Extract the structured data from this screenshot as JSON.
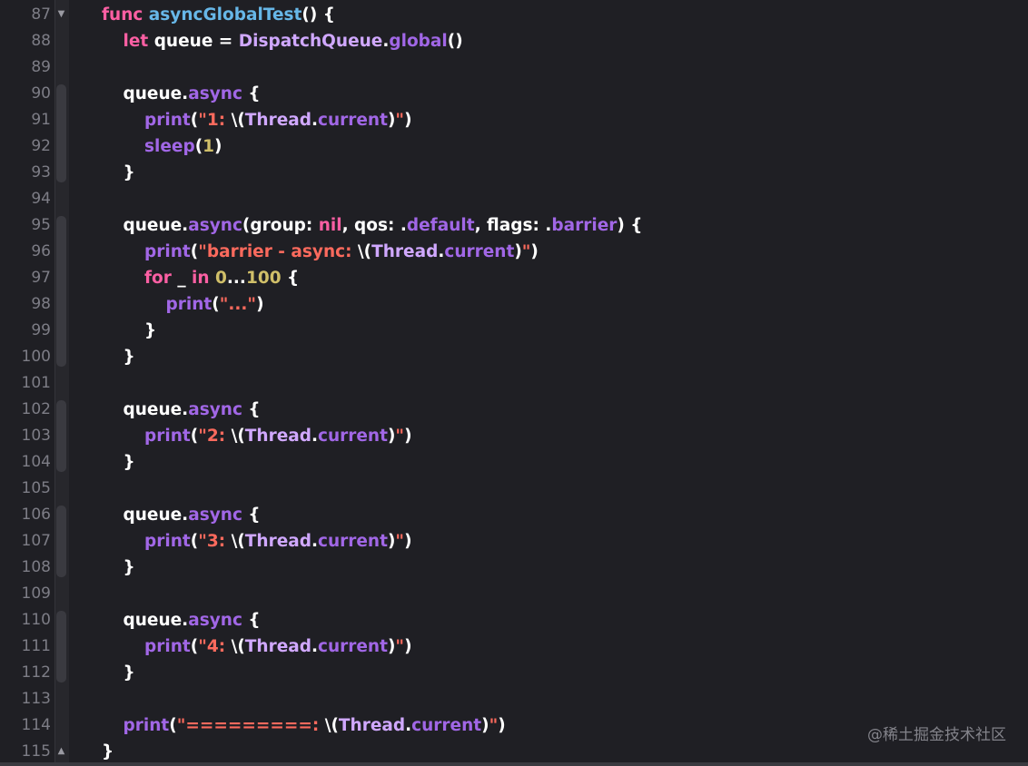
{
  "editor": {
    "lines": [
      {
        "n": "87",
        "indent": 0,
        "tokens": [
          [
            "kw",
            "func "
          ],
          [
            "fn",
            "asyncGlobalTest"
          ],
          [
            "pl",
            "() {"
          ]
        ]
      },
      {
        "n": "88",
        "indent": 1,
        "tokens": [
          [
            "kw",
            "let "
          ],
          [
            "pl",
            "queue = "
          ],
          [
            "ty",
            "DispatchQueue"
          ],
          [
            "pl",
            "."
          ],
          [
            "mt",
            "global"
          ],
          [
            "pl",
            "()"
          ]
        ]
      },
      {
        "n": "89",
        "indent": 0,
        "tokens": []
      },
      {
        "n": "90",
        "indent": 1,
        "tokens": [
          [
            "pl",
            "queue."
          ],
          [
            "mt",
            "async"
          ],
          [
            "pl",
            " {"
          ]
        ]
      },
      {
        "n": "91",
        "indent": 2,
        "tokens": [
          [
            "mt",
            "print"
          ],
          [
            "pl",
            "("
          ],
          [
            "st",
            "\"1: "
          ],
          [
            "pl",
            "\\("
          ],
          [
            "ty",
            "Thread"
          ],
          [
            "pl",
            "."
          ],
          [
            "mt",
            "current"
          ],
          [
            "pl",
            ")"
          ],
          [
            "st",
            "\""
          ],
          [
            "pl",
            ")"
          ]
        ]
      },
      {
        "n": "92",
        "indent": 2,
        "tokens": [
          [
            "mt",
            "sleep"
          ],
          [
            "pl",
            "("
          ],
          [
            "nu",
            "1"
          ],
          [
            "pl",
            ")"
          ]
        ]
      },
      {
        "n": "93",
        "indent": 1,
        "tokens": [
          [
            "pl",
            "}"
          ]
        ]
      },
      {
        "n": "94",
        "indent": 0,
        "tokens": []
      },
      {
        "n": "95",
        "indent": 1,
        "tokens": [
          [
            "pl",
            "queue."
          ],
          [
            "mt",
            "async"
          ],
          [
            "pl",
            "(group: "
          ],
          [
            "kw",
            "nil"
          ],
          [
            "pl",
            ", qos: ."
          ],
          [
            "mt",
            "default"
          ],
          [
            "pl",
            ", flags: ."
          ],
          [
            "mt",
            "barrier"
          ],
          [
            "pl",
            ") {"
          ]
        ]
      },
      {
        "n": "96",
        "indent": 2,
        "tokens": [
          [
            "mt",
            "print"
          ],
          [
            "pl",
            "("
          ],
          [
            "st",
            "\"barrier - async: "
          ],
          [
            "pl",
            "\\("
          ],
          [
            "ty",
            "Thread"
          ],
          [
            "pl",
            "."
          ],
          [
            "mt",
            "current"
          ],
          [
            "pl",
            ")"
          ],
          [
            "st",
            "\""
          ],
          [
            "pl",
            ")"
          ]
        ]
      },
      {
        "n": "97",
        "indent": 2,
        "tokens": [
          [
            "kw",
            "for "
          ],
          [
            "pl",
            "_ "
          ],
          [
            "kw",
            "in "
          ],
          [
            "nu",
            "0"
          ],
          [
            "pl",
            "..."
          ],
          [
            "nu",
            "100"
          ],
          [
            "pl",
            " {"
          ]
        ]
      },
      {
        "n": "98",
        "indent": 3,
        "tokens": [
          [
            "mt",
            "print"
          ],
          [
            "pl",
            "("
          ],
          [
            "st",
            "\"...\""
          ],
          [
            "pl",
            ")"
          ]
        ]
      },
      {
        "n": "99",
        "indent": 2,
        "tokens": [
          [
            "pl",
            "}"
          ]
        ]
      },
      {
        "n": "100",
        "indent": 1,
        "tokens": [
          [
            "pl",
            "}"
          ]
        ]
      },
      {
        "n": "101",
        "indent": 0,
        "tokens": []
      },
      {
        "n": "102",
        "indent": 1,
        "tokens": [
          [
            "pl",
            "queue."
          ],
          [
            "mt",
            "async"
          ],
          [
            "pl",
            " {"
          ]
        ]
      },
      {
        "n": "103",
        "indent": 2,
        "tokens": [
          [
            "mt",
            "print"
          ],
          [
            "pl",
            "("
          ],
          [
            "st",
            "\"2: "
          ],
          [
            "pl",
            "\\("
          ],
          [
            "ty",
            "Thread"
          ],
          [
            "pl",
            "."
          ],
          [
            "mt",
            "current"
          ],
          [
            "pl",
            ")"
          ],
          [
            "st",
            "\""
          ],
          [
            "pl",
            ")"
          ]
        ]
      },
      {
        "n": "104",
        "indent": 1,
        "tokens": [
          [
            "pl",
            "}"
          ]
        ]
      },
      {
        "n": "105",
        "indent": 0,
        "tokens": []
      },
      {
        "n": "106",
        "indent": 1,
        "tokens": [
          [
            "pl",
            "queue."
          ],
          [
            "mt",
            "async"
          ],
          [
            "pl",
            " {"
          ]
        ]
      },
      {
        "n": "107",
        "indent": 2,
        "tokens": [
          [
            "mt",
            "print"
          ],
          [
            "pl",
            "("
          ],
          [
            "st",
            "\"3: "
          ],
          [
            "pl",
            "\\("
          ],
          [
            "ty",
            "Thread"
          ],
          [
            "pl",
            "."
          ],
          [
            "mt",
            "current"
          ],
          [
            "pl",
            ")"
          ],
          [
            "st",
            "\""
          ],
          [
            "pl",
            ")"
          ]
        ]
      },
      {
        "n": "108",
        "indent": 1,
        "tokens": [
          [
            "pl",
            "}"
          ]
        ]
      },
      {
        "n": "109",
        "indent": 0,
        "tokens": []
      },
      {
        "n": "110",
        "indent": 1,
        "tokens": [
          [
            "pl",
            "queue."
          ],
          [
            "mt",
            "async"
          ],
          [
            "pl",
            " {"
          ]
        ]
      },
      {
        "n": "111",
        "indent": 2,
        "tokens": [
          [
            "mt",
            "print"
          ],
          [
            "pl",
            "("
          ],
          [
            "st",
            "\"4: "
          ],
          [
            "pl",
            "\\("
          ],
          [
            "ty",
            "Thread"
          ],
          [
            "pl",
            "."
          ],
          [
            "mt",
            "current"
          ],
          [
            "pl",
            ")"
          ],
          [
            "st",
            "\""
          ],
          [
            "pl",
            ")"
          ]
        ]
      },
      {
        "n": "112",
        "indent": 1,
        "tokens": [
          [
            "pl",
            "}"
          ]
        ]
      },
      {
        "n": "113",
        "indent": 0,
        "tokens": []
      },
      {
        "n": "114",
        "indent": 1,
        "tokens": [
          [
            "mt",
            "print"
          ],
          [
            "pl",
            "("
          ],
          [
            "st",
            "\"=========: "
          ],
          [
            "pl",
            "\\("
          ],
          [
            "ty",
            "Thread"
          ],
          [
            "pl",
            "."
          ],
          [
            "mt",
            "current"
          ],
          [
            "pl",
            ")"
          ],
          [
            "st",
            "\""
          ],
          [
            "pl",
            ")"
          ]
        ]
      },
      {
        "n": "115",
        "indent": 0,
        "tokens": [
          [
            "pl",
            "}"
          ]
        ]
      }
    ],
    "fold_open_icon": "chevron-down-icon",
    "fold_close_icon": "chevron-up-icon",
    "colors": {
      "background": "#1f1f24",
      "keyword": "#fc5fa3",
      "function_name": "#67b7e8",
      "type": "#d0a8ff",
      "method": "#a167e6",
      "string": "#fc6a5d",
      "number": "#d0bf69",
      "plain": "#ffffff",
      "line_number": "#7d7d86"
    }
  },
  "watermark": {
    "text": "@稀土掘金技术社区"
  }
}
